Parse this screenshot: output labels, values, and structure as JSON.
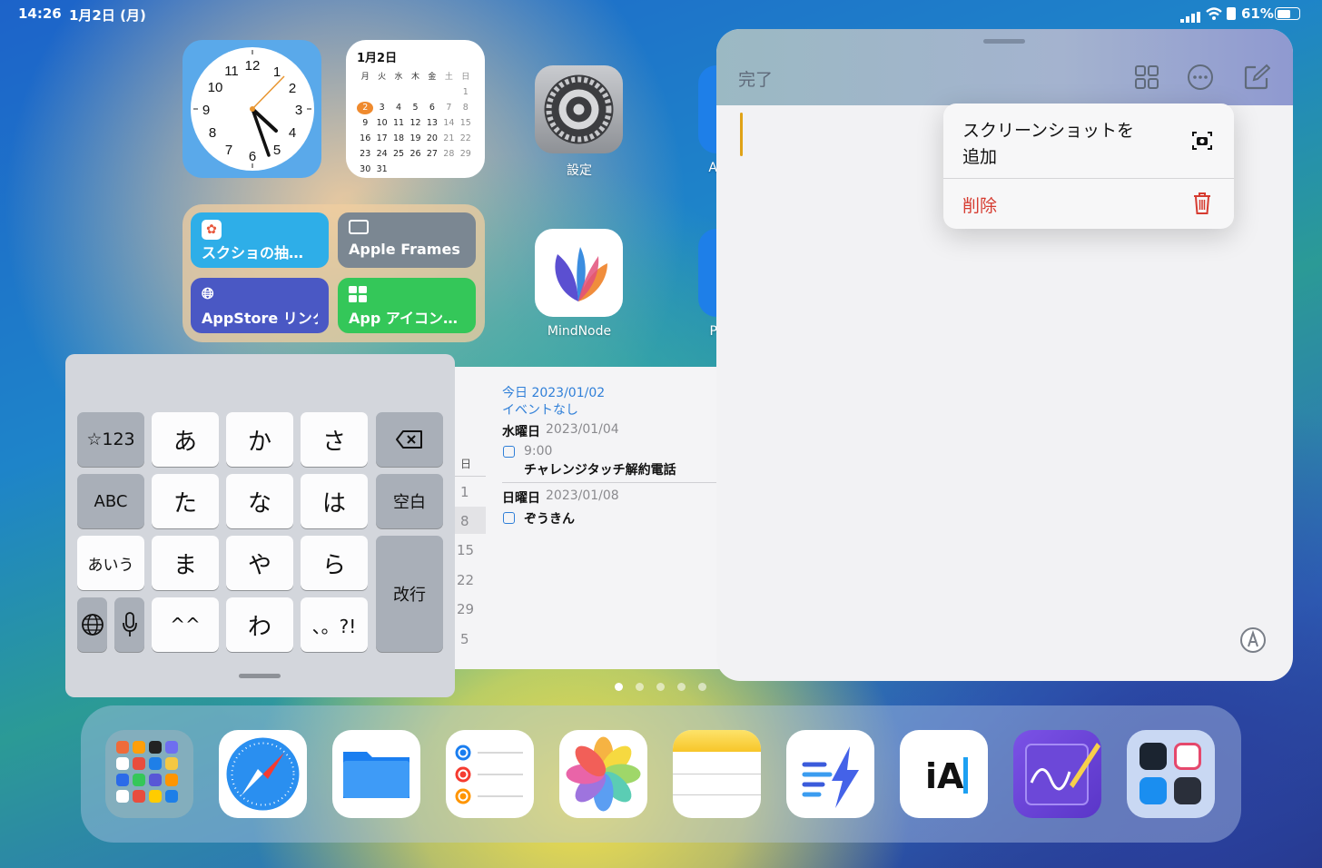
{
  "status_bar": {
    "time": "14:26",
    "date": "1月2日 (月)",
    "battery": "61%",
    "icons": [
      "cellular-signal-icon",
      "wifi-icon",
      "orientation-lock-icon",
      "battery-icon"
    ]
  },
  "clock_widget": {
    "numbers": [
      "12",
      "1",
      "2",
      "3",
      "4",
      "5",
      "6",
      "7",
      "8",
      "9",
      "10",
      "11"
    ]
  },
  "calendar_widget": {
    "title": "1月2日",
    "weekdays": [
      "月",
      "火",
      "水",
      "木",
      "金",
      "土",
      "日"
    ],
    "rows": [
      [
        "",
        "",
        "",
        "",
        "",
        "",
        "1"
      ],
      [
        "2",
        "3",
        "4",
        "5",
        "6",
        "7",
        "8"
      ],
      [
        "9",
        "10",
        "11",
        "12",
        "13",
        "14",
        "15"
      ],
      [
        "16",
        "17",
        "18",
        "19",
        "20",
        "21",
        "22"
      ],
      [
        "23",
        "24",
        "25",
        "26",
        "27",
        "28",
        "29"
      ],
      [
        "30",
        "31",
        "",
        "",
        "",
        "",
        ""
      ]
    ],
    "today": "2"
  },
  "shortcuts_widget": {
    "buttons": [
      {
        "label": "スクショの抽…",
        "icon": "photos-icon",
        "color": "#2eaee8"
      },
      {
        "label": "Apple Frames",
        "icon": "display-frame-icon",
        "color": "#7b8792"
      },
      {
        "label": "AppStore リンク",
        "icon": "globe-icon",
        "color": "#4a58c4"
      },
      {
        "label": "App アイコン…",
        "icon": "grid-icon",
        "color": "#34c759"
      }
    ]
  },
  "home_apps": {
    "settings": "設定",
    "mindnode": "MindNode",
    "partial_1": "A",
    "partial_2": "P"
  },
  "events": {
    "today_label": "今日 2023/01/02",
    "no_events": "イベントなし",
    "wed_day": "水曜日",
    "wed_date": "2023/01/04",
    "wed_time": "9:00",
    "wed_title": "チャレンジタッチ解約電話",
    "sun_day": "日曜日",
    "sun_date": "2023/01/08",
    "sun_title": "ぞうきん",
    "side_header": "日",
    "side_days": [
      "1",
      "8",
      "15",
      "22",
      "29",
      "5"
    ]
  },
  "keyboard": {
    "k_num": "☆123",
    "k_a": "あ",
    "k_ka": "か",
    "k_sa": "さ",
    "k_abc": "ABC",
    "k_ta": "た",
    "k_na": "な",
    "k_ha": "は",
    "k_space": "空白",
    "k_kana": "あいう",
    "k_ma": "ま",
    "k_ya": "や",
    "k_ra": "ら",
    "k_return": "改行",
    "k_emoji": "^^",
    "k_wa": "わ",
    "k_punct": "、。?!",
    "icons": [
      "delete-icon",
      "globe-icon",
      "microphone-icon"
    ]
  },
  "notes": {
    "done": "完了",
    "toolbar_icons": [
      "gallery-grid-icon",
      "more-icon",
      "compose-icon"
    ],
    "markup_icon": "markup-pen-icon"
  },
  "context_menu": {
    "add_screenshot": "スクリーンショットを追加",
    "add_screenshot_line1": "スクリーンショットを",
    "add_screenshot_line2": "追加",
    "delete": "削除",
    "delete_color": "#d63b30"
  },
  "page_dots": {
    "count": 5,
    "active": 0
  },
  "dock": {
    "apps": [
      "app-library-folder-icon",
      "safari-icon",
      "files-icon",
      "reminders-icon",
      "photos-icon",
      "notes-icon",
      "drafts-icon",
      "ia-writer-icon",
      "goodnotes-icon",
      "utilities-folder-icon"
    ]
  }
}
